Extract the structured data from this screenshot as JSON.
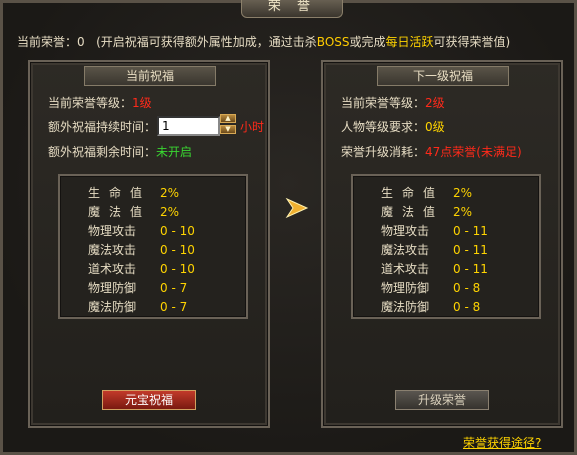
{
  "window": {
    "title": "荣 誉"
  },
  "summary": {
    "honor_label": "当前荣誉：",
    "honor_value": "0",
    "hint_prefix": "(开启祝福可获得额外属性加成，通过击杀",
    "hint_boss": "BOSS",
    "hint_mid": "或完成",
    "hint_daily": "每日活跃",
    "hint_suffix": "可获得荣誉值)"
  },
  "current": {
    "header": "当前祝福",
    "level_label": "当前荣誉等级：",
    "level_value": "1级",
    "duration_label": "额外祝福持续时间：",
    "duration_input": "1",
    "duration_unit": "小时",
    "remaining_label": "额外祝福剩余时间：",
    "remaining_value": "未开启",
    "stats": [
      {
        "label": "生命值",
        "value": "2%"
      },
      {
        "label": "魔法值",
        "value": "2%"
      },
      {
        "label": "物理攻击",
        "value": "0 - 10"
      },
      {
        "label": "魔法攻击",
        "value": "0 - 10"
      },
      {
        "label": "道术攻击",
        "value": "0 - 10"
      },
      {
        "label": "物理防御",
        "value": "0 - 7"
      },
      {
        "label": "魔法防御",
        "value": "0 - 7"
      }
    ],
    "button": "元宝祝福"
  },
  "next": {
    "header": "下一级祝福",
    "level_label": "当前荣誉等级：",
    "level_value": "2级",
    "req_label": "人物等级要求：",
    "req_value": "0级",
    "cost_label": "荣誉升级消耗：",
    "cost_value": "47点荣誉(未满足)",
    "stats": [
      {
        "label": "生命值",
        "value": "2%"
      },
      {
        "label": "魔法值",
        "value": "2%"
      },
      {
        "label": "物理攻击",
        "value": "0 - 11"
      },
      {
        "label": "魔法攻击",
        "value": "0 - 11"
      },
      {
        "label": "道术攻击",
        "value": "0 - 11"
      },
      {
        "label": "物理防御",
        "value": "0 - 8"
      },
      {
        "label": "魔法防御",
        "value": "0 - 8"
      }
    ],
    "button": "升级荣誉"
  },
  "footer_link": "荣誉获得途径?",
  "icons": {
    "arrow": "arrow-right-icon",
    "spinner_up": "chevron-up-icon",
    "spinner_down": "chevron-down-icon"
  }
}
